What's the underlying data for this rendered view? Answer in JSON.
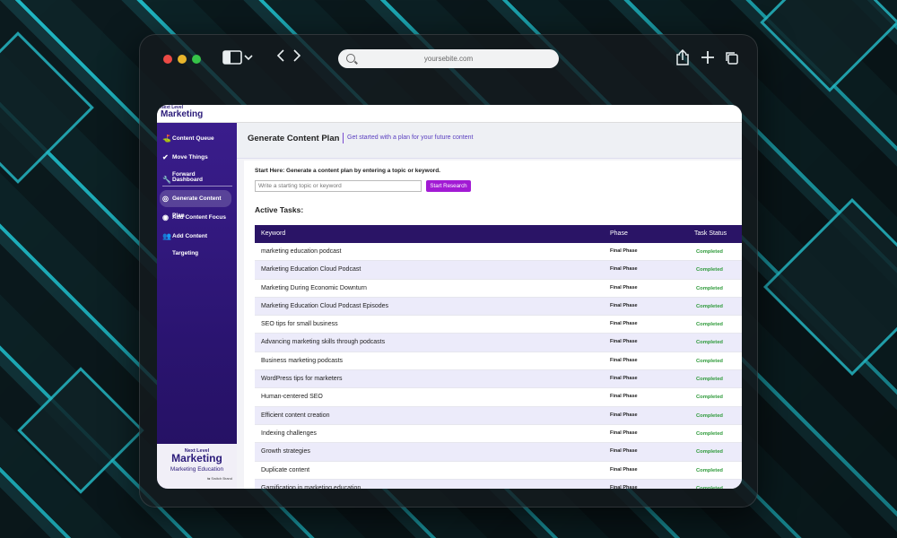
{
  "browser": {
    "url": "yoursebite.com"
  },
  "brand": {
    "logo_top": "Next Level",
    "logo_main": "Marketing"
  },
  "sidebar": {
    "items": [
      {
        "label": "Content Queue",
        "icon": "queue-icon"
      },
      {
        "label": "Move Things Forward",
        "icon": "check-arrow-icon"
      },
      {
        "label": "Dashboard",
        "icon": "wrench-icon"
      },
      {
        "label": "Generate Content Plan",
        "icon": "target-icon",
        "active": true
      },
      {
        "label": "Add Content Focus",
        "icon": "focus-icon"
      },
      {
        "label": "Add Content Targeting",
        "icon": "users-icon"
      }
    ],
    "footer": {
      "logo_top": "Next Level",
      "logo_main": "Marketing",
      "workspace": "Marketing Education",
      "switch_label": "⇆ Switch Brand"
    }
  },
  "header": {
    "title": "Generate Content Plan",
    "subtitle": "Get started with a plan for your future content"
  },
  "start": {
    "instruction": "Start Here: Generate a content plan by entering a topic or keyword.",
    "placeholder": "Write a starting topic or keyword",
    "button": "Start Research"
  },
  "tasks": {
    "title": "Active Tasks:",
    "columns": [
      "Keyword",
      "Phase",
      "Task Status"
    ],
    "rows": [
      {
        "keyword": "marketing education podcast",
        "phase": "Final Phase",
        "status": "Completed"
      },
      {
        "keyword": "Marketing Education Cloud Podcast",
        "phase": "Final Phase",
        "status": "Completed"
      },
      {
        "keyword": "Marketing During Economic Downturn",
        "phase": "Final Phase",
        "status": "Completed"
      },
      {
        "keyword": "Marketing Education Cloud Podcast Episodes",
        "phase": "Final Phase",
        "status": "Completed"
      },
      {
        "keyword": "SEO tips for small business",
        "phase": "Final Phase",
        "status": "Completed"
      },
      {
        "keyword": "Advancing marketing skills through podcasts",
        "phase": "Final Phase",
        "status": "Completed"
      },
      {
        "keyword": "Business marketing podcasts",
        "phase": "Final Phase",
        "status": "Completed"
      },
      {
        "keyword": "WordPress tips for marketers",
        "phase": "Final Phase",
        "status": "Completed"
      },
      {
        "keyword": "Human-centered SEO",
        "phase": "Final Phase",
        "status": "Completed"
      },
      {
        "keyword": "Efficient content creation",
        "phase": "Final Phase",
        "status": "Completed"
      },
      {
        "keyword": "Indexing challenges",
        "phase": "Final Phase",
        "status": "Completed"
      },
      {
        "keyword": "Growth strategies",
        "phase": "Final Phase",
        "status": "Completed"
      },
      {
        "keyword": "Duplicate content",
        "phase": "Final Phase",
        "status": "Completed"
      },
      {
        "keyword": "Gamification in marketing education",
        "phase": "Final Phase",
        "status": "Completed"
      }
    ]
  },
  "colors": {
    "sidebar": "#2a1470",
    "accent_button": "#a21ad4",
    "table_header": "#2a1466",
    "status_completed": "#2e9a3a"
  }
}
